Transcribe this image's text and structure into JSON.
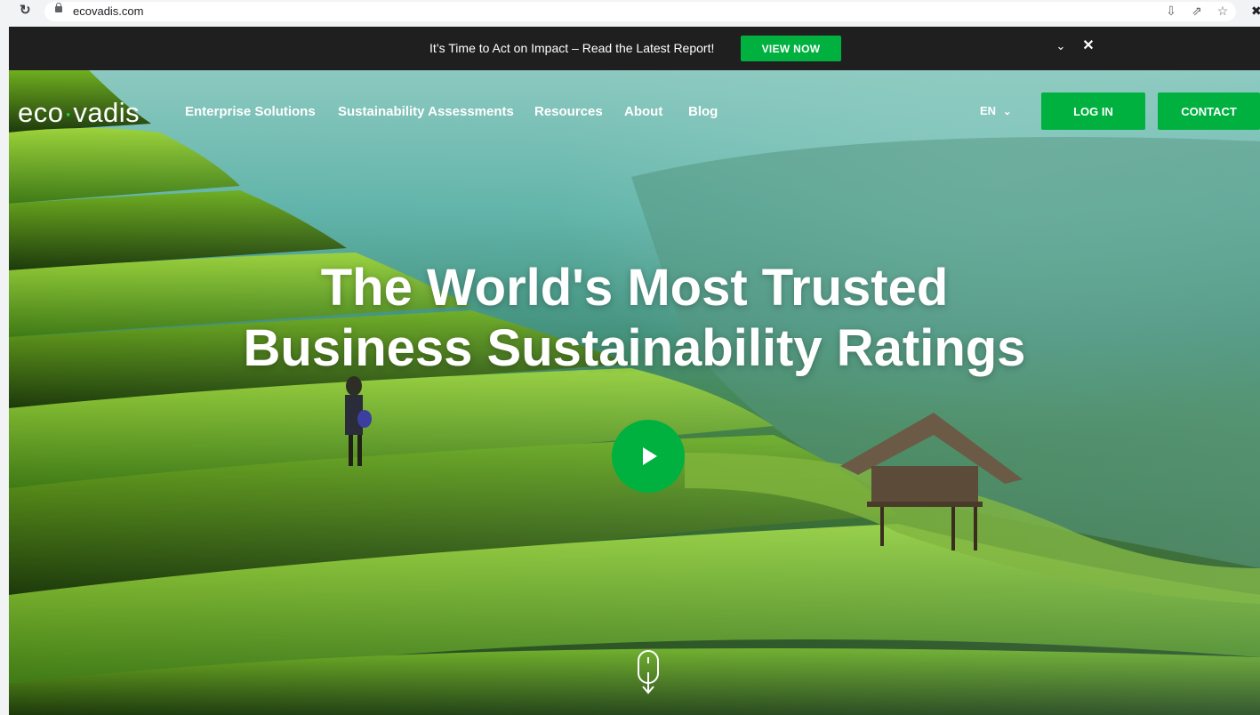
{
  "browser": {
    "url": "ecovadis.com"
  },
  "announcement": {
    "message": "It’s Time to Act on Impact – Read the Latest Report!",
    "cta_label": "VIEW NOW"
  },
  "header": {
    "logo_text_before": "eco",
    "logo_text_after": "vadis",
    "nav": [
      {
        "label": "Enterprise Solutions"
      },
      {
        "label": "Sustainability Assessments"
      },
      {
        "label": "Resources"
      },
      {
        "label": "About"
      },
      {
        "label": "Blog"
      }
    ],
    "language": "EN",
    "login_label": "LOG IN",
    "contact_label": "CONTACT"
  },
  "hero": {
    "headline_line1": "The World's Most Trusted",
    "headline_line2": "Business Sustainability Ratings"
  },
  "colors": {
    "brand_green": "#00b140",
    "announcement_bg": "#1f1f1f"
  },
  "icons": [
    "reload-icon",
    "lock-icon",
    "install-icon",
    "share-icon",
    "star-icon",
    "chevron-down-icon",
    "close-icon",
    "play-icon",
    "scroll-down-icon"
  ]
}
